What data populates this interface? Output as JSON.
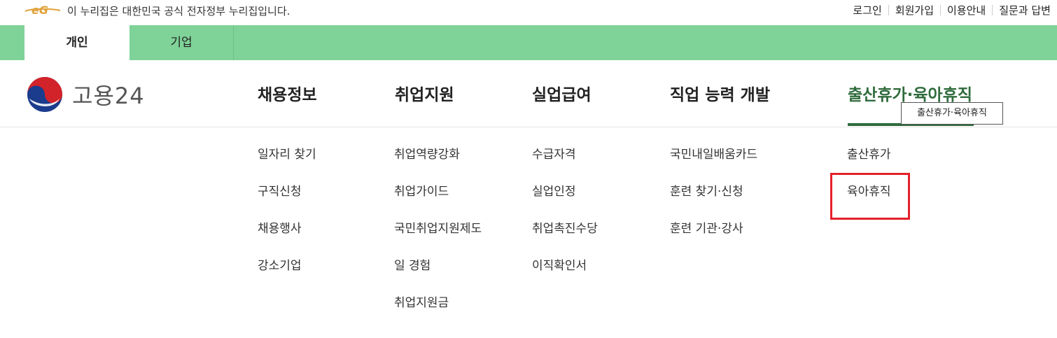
{
  "topbar": {
    "notice": "이 누리집은 대한민국 공식 전자정부 누리집입니다.",
    "links": [
      "로그인",
      "회원가입",
      "이용안내",
      "질문과 답변"
    ]
  },
  "tabs": [
    "개인",
    "기업"
  ],
  "brand": {
    "name": "고용24"
  },
  "gnb": [
    {
      "label": "채용정보",
      "items": [
        "일자리 찾기",
        "구직신청",
        "채용행사",
        "강소기업"
      ]
    },
    {
      "label": "취업지원",
      "items": [
        "취업역량강화",
        "취업가이드",
        "국민취업지원제도",
        "일 경험",
        "취업지원금"
      ]
    },
    {
      "label": "실업급여",
      "items": [
        "수급자격",
        "실업인정",
        "취업촉진수당",
        "이직확인서"
      ]
    },
    {
      "label": "직업 능력 개발",
      "items": [
        "국민내일배움카드",
        "훈련 찾기·신청",
        "훈련 기관·강사"
      ]
    },
    {
      "label": "출산휴가·육아휴직",
      "items": [
        "출산휴가",
        "육아휴직"
      ]
    }
  ],
  "tooltip": "출산휴가·육아휴직",
  "colors": {
    "green_bar": "#7fd398",
    "active": "#2f6b3c",
    "highlight": "#e3202a"
  }
}
